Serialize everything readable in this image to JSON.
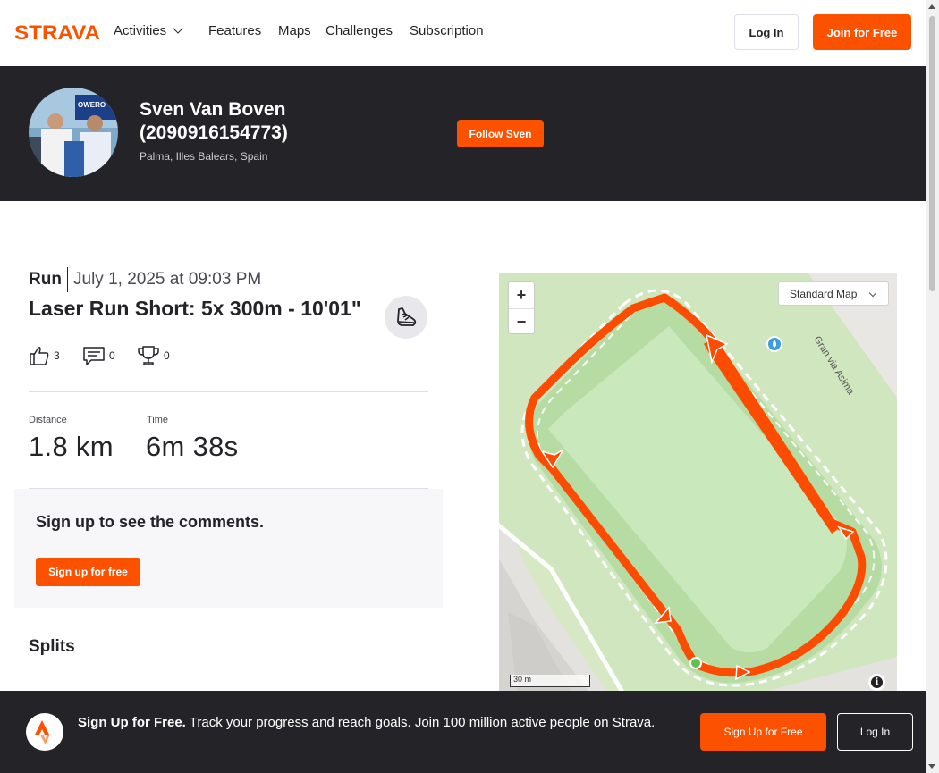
{
  "brand": {
    "logo_text": "STRAVA",
    "accent": "#fc5200",
    "dark": "#242428"
  },
  "nav": {
    "items": [
      "Activities",
      "Features",
      "Maps",
      "Challenges",
      "Subscription"
    ],
    "login_label": "Log In",
    "join_label": "Join for Free"
  },
  "athlete": {
    "name": "Sven Van Boven (2090916154773)",
    "location": "Palma, Illes Balears, Spain",
    "follow_label": "Follow Sven"
  },
  "activity": {
    "type": "Run",
    "date": "July 1, 2025 at 09:03 PM",
    "title": "Laser Run Short: 5x 300m - 10'01\"",
    "kudos": "3",
    "comments": "0",
    "achievements": "0",
    "stats": [
      {
        "label": "Distance",
        "value": "1.8 km"
      },
      {
        "label": "Time",
        "value": "6m 38s"
      }
    ]
  },
  "comments_prompt": {
    "title": "Sign up to see the comments.",
    "button": "Sign up for free"
  },
  "splits": {
    "title": "Splits"
  },
  "map": {
    "zoom_in": "+",
    "zoom_out": "−",
    "style_selected": "Standard Map",
    "street_label": "Gran via Asima",
    "scale_label": "30 m",
    "info": "i",
    "route_color": "#fc4c02",
    "track_color": "#62c04c"
  },
  "footer": {
    "headline": "Sign Up for Free.",
    "body": "Track your progress and reach goals. Join 100 million active people on Strava.",
    "signup_label": "Sign Up for Free",
    "login_label": "Log In"
  }
}
